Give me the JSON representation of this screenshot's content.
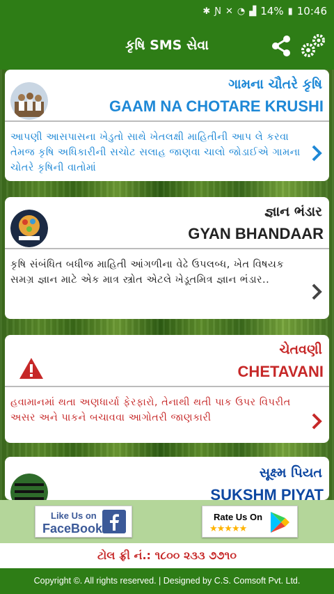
{
  "status_bar": {
    "battery": "14%",
    "time": "10:46",
    "icons": [
      "bluetooth-icon",
      "nfc-icon",
      "mute-icon",
      "wifi-icon",
      "signal-icon",
      "battery-icon"
    ]
  },
  "app_bar": {
    "title": "કૃષિ SMS સેવા",
    "share_icon": "share-icon",
    "settings_icon": "gear-icon"
  },
  "cards": [
    {
      "title_gu": "ગામના ચૌતરે કૃષિ",
      "title_en": "GAAM NA CHOTARE KRUSHI",
      "description": "આપણી આસપાસના ખેડુતો સાથે ખેતલક્ષી માહિતીની આપ લે કરવા તેમજ કૃષિ અધિકારીની સચોટ સલાહ જાણવા ચાલો જોડાઈએ ગામના ચોતરે કૃષિની વાતોમાં",
      "color": "#1e88d6"
    },
    {
      "title_gu": "જ્ઞાન ભંડાર",
      "title_en": "GYAN BHANDAAR",
      "description": "કૃષિ સંબંધિત બધીજ માહિતી આંગળીના વેઢે ઉપલબ્ધ, ખેત વિષયક સમગ્ર જ્ઞાન માટે એક માત્ર સ્ત્રોત એટલે ખેડૂતમિત્ર જ્ઞાન ભંડાર..",
      "color": "#222222"
    },
    {
      "title_gu": "ચેતવણી",
      "title_en": "CHETAVANI",
      "description": "હવામાનમાં થતા અણધાર્યા ફેરફારો, તેનાથી થતી પાક ઉપર વિપરીત અસર અને પાકને બચાવવા આગોતરી જાણકારી",
      "color": "#c62828"
    },
    {
      "title_gu": "સૂક્ષ્મ પિયત",
      "title_en": "SUKSHM PIYAT",
      "color": "#0d47a1"
    }
  ],
  "bottom_bar": {
    "facebook": {
      "line1": "Like Us on",
      "line2": "FaceBook"
    },
    "rate": {
      "line1": "Rate Us On",
      "stars": "★★★★★"
    }
  },
  "toll_free": "ટોલ ફ્રી નં.: ૧૮૦૦ ૨૩૩ ૭૭૧૦",
  "footer": "Copyright ©. All rights reserved. | Designed by C.S. Comsoft Pvt. Ltd."
}
